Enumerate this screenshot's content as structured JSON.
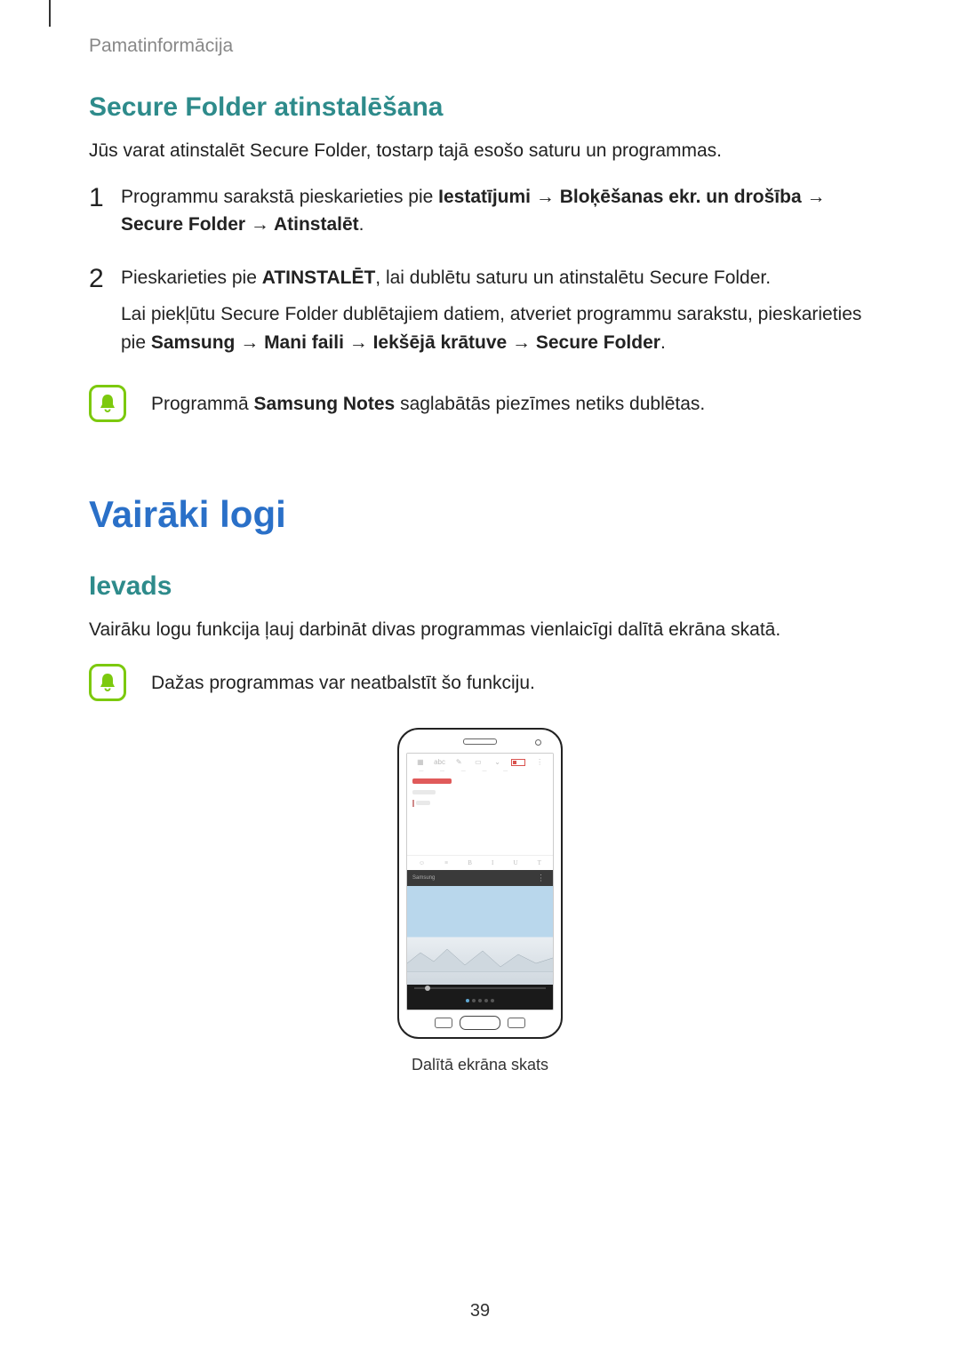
{
  "breadcrumb": "Pamatinformācija",
  "section1": {
    "heading": "Secure Folder atinstalēšana",
    "intro": "Jūs varat atinstalēt Secure Folder, tostarp tajā esošo saturu un programmas.",
    "steps": [
      {
        "num": "1",
        "parts": [
          {
            "t": "Programmu sarakstā pieskarieties pie ",
            "b": false
          },
          {
            "t": "Iestatījumi",
            "b": true
          },
          {
            "t": " → ",
            "b": true
          },
          {
            "t": "Bloķēšanas ekr. un drošība",
            "b": true
          },
          {
            "t": " → ",
            "b": true
          },
          {
            "t": "Secure Folder",
            "b": true
          },
          {
            "t": " → ",
            "b": true
          },
          {
            "t": "Atinstalēt",
            "b": true
          },
          {
            "t": ".",
            "b": false
          }
        ]
      },
      {
        "num": "2",
        "line1": [
          {
            "t": "Pieskarieties pie ",
            "b": false
          },
          {
            "t": "ATINSTALĒT",
            "b": true
          },
          {
            "t": ", lai dublētu saturu un atinstalētu Secure Folder.",
            "b": false
          }
        ],
        "line2": [
          {
            "t": "Lai piekļūtu Secure Folder dublētajiem datiem, atveriet programmu sarakstu, pieskarieties pie ",
            "b": false
          },
          {
            "t": "Samsung",
            "b": true
          },
          {
            "t": " → ",
            "b": true
          },
          {
            "t": "Mani faili",
            "b": true
          },
          {
            "t": " → ",
            "b": true
          },
          {
            "t": "Iekšējā krātuve",
            "b": true
          },
          {
            "t": " → ",
            "b": true
          },
          {
            "t": "Secure Folder",
            "b": true
          },
          {
            "t": ".",
            "b": false
          }
        ]
      }
    ],
    "note": {
      "parts": [
        {
          "t": "Programmā ",
          "b": false
        },
        {
          "t": "Samsung Notes",
          "b": true
        },
        {
          "t": " saglabātās piezīmes netiks dublētas.",
          "b": false
        }
      ]
    }
  },
  "section2": {
    "title": "Vairāki logi",
    "sub": "Ievads",
    "intro": "Vairāku logu funkcija ļauj darbināt divas programmas vienlaicīgi dalītā ekrāna skatā.",
    "note": "Dažas programmas var neatbalstīt šo funkciju.",
    "caption": "Dalītā ekrāna skats"
  },
  "phone_mock": {
    "top_tabs": [
      "abc"
    ],
    "format_icons": [
      "☺",
      "≡",
      "B",
      "I",
      "U",
      "T"
    ],
    "divider_label": "Samsung"
  },
  "page_number": "39",
  "icons": {
    "note": "bell-icon"
  },
  "colors": {
    "teal": "#2e8b8b",
    "blue": "#2a70c8",
    "green": "#7cc90e"
  }
}
